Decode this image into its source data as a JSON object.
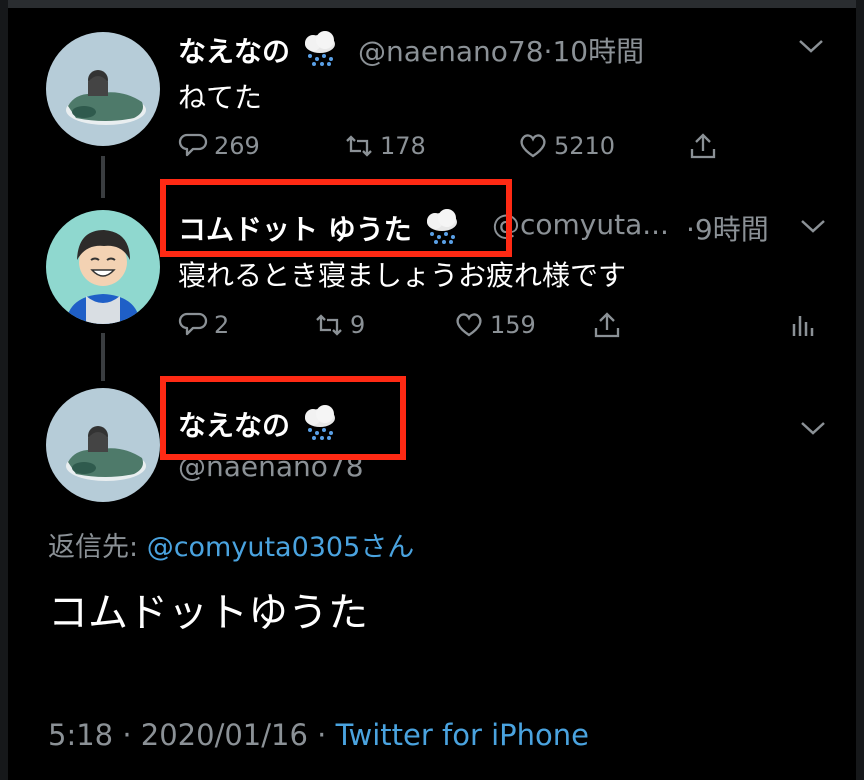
{
  "tweet1": {
    "name": "なえなの",
    "handle": "@naenano78",
    "dot": "·",
    "time": "10時間",
    "text": "ねてた",
    "replies": "269",
    "retweets": "178",
    "likes": "5210"
  },
  "tweet2": {
    "name": "コムドット ゆうた",
    "handle": "@comyuta...",
    "dot": "·",
    "time": "9時間",
    "text": "寝れるとき寝ましょうお疲れ様です",
    "replies": "2",
    "retweets": "9",
    "likes": "159"
  },
  "tweet3": {
    "name": "なえなの",
    "handle": "@naenano78",
    "reply_label": "返信先: ",
    "reply_mention": "@comyuta0305さん",
    "text": "コムドットゆうた",
    "time": "5:18",
    "sep1": " · ",
    "date": "2020/01/16",
    "sep2": " · ",
    "source": "Twitter for iPhone"
  },
  "colors": {
    "background": "#000000",
    "link": "#4aa3df",
    "muted": "#8b9196",
    "highlight_box": "#ff2a14"
  },
  "icons": {
    "reply": "reply-icon",
    "retweet": "retweet-icon",
    "like": "heart-icon",
    "share": "share-icon",
    "analytics": "analytics-icon",
    "more": "chevron-down-icon",
    "emoji": "rain-cloud-icon"
  }
}
